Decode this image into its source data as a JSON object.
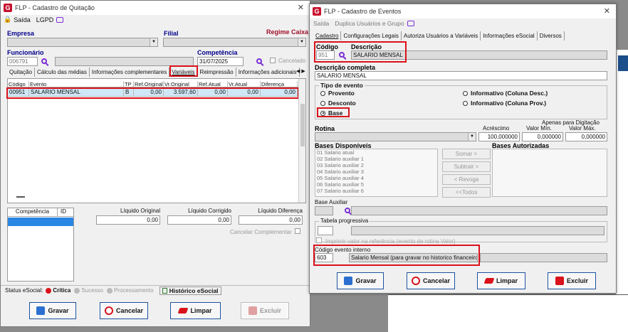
{
  "left": {
    "title": "FLP - Cadastro de Quitação",
    "menu": {
      "sair": "Saída",
      "lgpd": "LGPD"
    },
    "empresa_label": "Empresa",
    "filial_label": "Filial",
    "regime_caixa": "Regime Caixa",
    "funcionario_label": "Funcionário",
    "funcionario_code": "006791",
    "competencia_label": "Competência",
    "competencia_value": "31/07/2025",
    "cancelado": "Cancelado",
    "tabs": [
      "Quitação",
      "Cálculo das médias",
      "Informações complementares",
      "Variáveis",
      "Reimpressão",
      "Informações adicionais"
    ],
    "grid_headers": [
      "Código",
      "Evento",
      "TP",
      "Ref.Original",
      "Vr.Original",
      "Ref.Atual",
      "Vr.Atual",
      "Diferença"
    ],
    "grid_row": [
      "00951",
      "SALARIO MENSAL",
      "B",
      "0,00",
      "3.597,60",
      "0,00",
      "0,00",
      "0,00"
    ],
    "competencia_col": "Competência",
    "id_col": "ID",
    "liq_original_label": "Líquido Original",
    "liq_original": "0,00",
    "liq_corrigido_label": "Líquido Corrigido",
    "liq_corrigido": "0,00",
    "liq_diferenca_label": "Líquido Diferença",
    "liq_diferenca": "0,00",
    "cancelar_complementar": "Cancelar Complementar",
    "status_esocial": "Status eSocial:",
    "critica": "Crítica",
    "sucesso": "Sucesso",
    "processamento": "Processamento",
    "historico": "Histórico eSocial",
    "buttons": {
      "gravar": "Gravar",
      "cancelar": "Cancelar",
      "limpar": "Limpar",
      "excluir": "Excluir"
    }
  },
  "right": {
    "title": "FLP - Cadastro de Eventos",
    "menu": {
      "sair": "Saída",
      "duplica": "Duplica Usuários e Grupo"
    },
    "tabs": [
      "Cadastro",
      "Configurações Legais",
      "Autoriza Usuários a Variáveis",
      "Informações eSocial",
      "Diversos"
    ],
    "codigo_label": "Código",
    "codigo_value": "951",
    "descricao_label": "Descrição",
    "descricao_value": "SALARIO MENSAL",
    "desc_completa_label": "Descrição completa",
    "desc_completa_value": "SALARIO MENSAL",
    "tipo_evento_label": "Tipo de evento",
    "tipo_opts": {
      "provento": "Provento",
      "desconto": "Desconto",
      "base": "Base",
      "inf_desc": "Informativo (Coluna Desc.)",
      "inf_prov": "Informativo (Coluna Prov.)"
    },
    "rotina_label": "Rotina",
    "apenas_digitacao": "Apenas para Digitação",
    "acrescimo_label": "Acréscimo",
    "acrescimo": "100,000000",
    "valor_min_label": "Valor Mín.",
    "valor_min": "0,000000",
    "valor_max_label": "Valor Máx.",
    "valor_max": "0,000000",
    "bases_disp_label": "Bases Disponíveis",
    "bases_aut_label": "Bases Autorizadas",
    "bases": [
      "01 Salario atual",
      "02 Salario auxiliar 1",
      "03 Salario auxiliar 2",
      "04 Salario auxiliar 3",
      "05 Salario auxiliar 4",
      "06 Salario auxiliar 5",
      "07 Salario auxiliar 6"
    ],
    "somar": "Somar >",
    "subtrair": "Subtrair >",
    "revoga": "< Revoga",
    "todos": "<<Todos",
    "base_aux_label": "Base Auxiliar",
    "tabela_prog_label": "Tabela progressiva",
    "imprimir_label": "Imprimir valor na referência (evento de rotina Valor)",
    "cod_interno_label": "Código evento interno",
    "cod_interno_value": "603",
    "cod_interno_desc": "Salario Mensal (para gravar no historico financeiro",
    "buttons": {
      "gravar": "Gravar",
      "cancelar": "Cancelar",
      "limpar": "Limpar",
      "excluir": "Excluir"
    }
  },
  "colors": {
    "highlight": "#d9121b",
    "brand": "#c8102e",
    "accent": "#1a4f9c"
  }
}
